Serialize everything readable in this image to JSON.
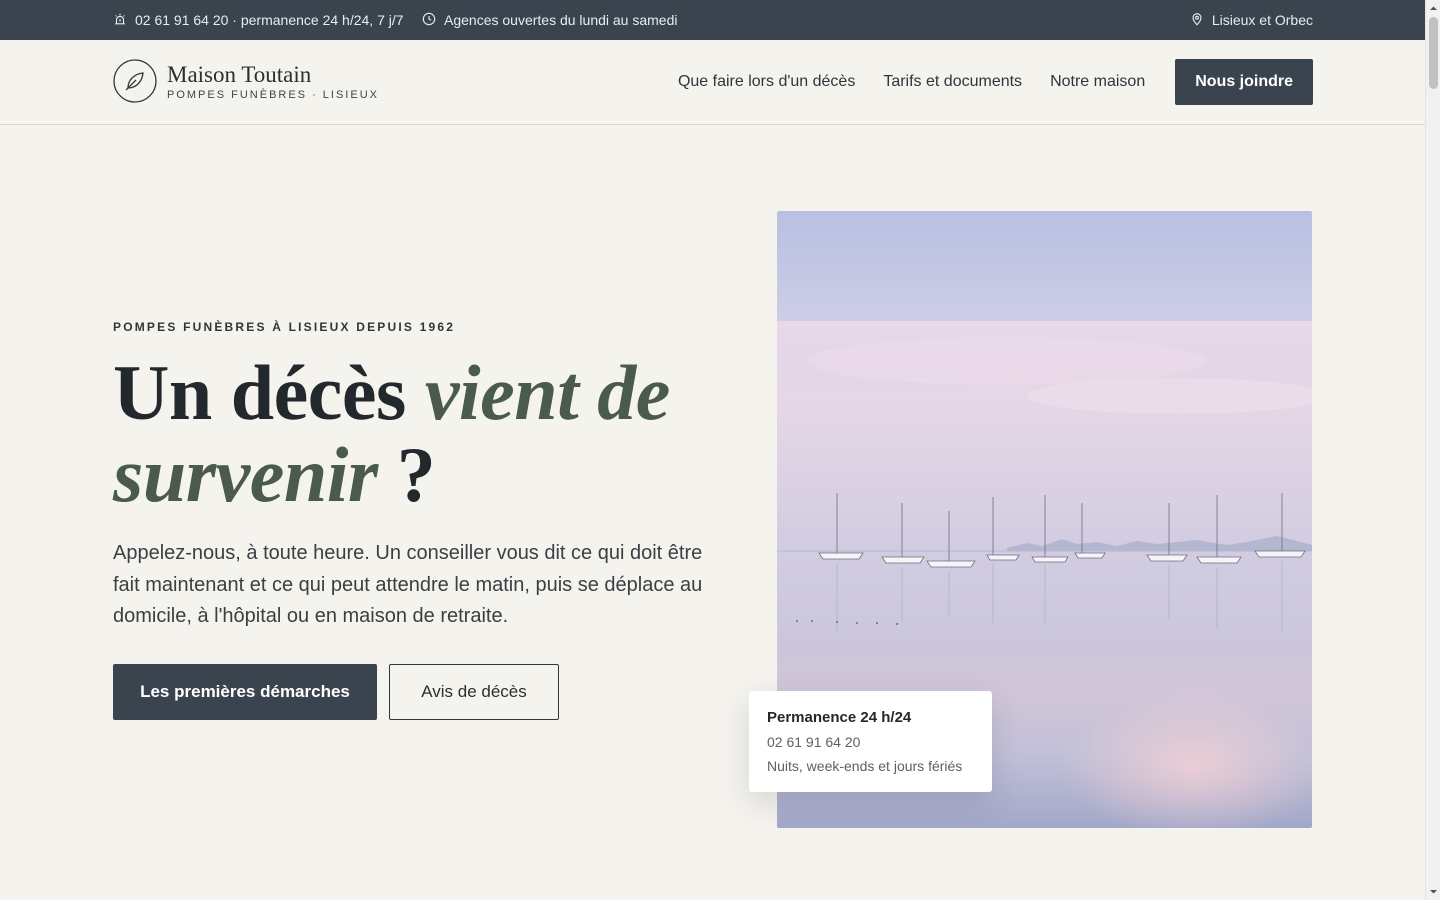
{
  "topbar": {
    "phone_text": "02 61 91 64 20 · permanence 24 h/24, 7 j/7",
    "phone_icon": "siren-icon",
    "hours_text": "Agences ouvertes du lundi au samedi",
    "hours_icon": "clock-icon",
    "location_text": "Lisieux et Orbec",
    "location_icon": "map-pin-icon"
  },
  "header": {
    "logo_name": "Maison Toutain",
    "logo_sub": "POMPES FUNÈBRES · LISIEUX",
    "logo_icon": "leaf-icon",
    "nav": [
      {
        "label": "Que faire lors d'un décès"
      },
      {
        "label": "Tarifs et documents"
      },
      {
        "label": "Notre maison"
      }
    ],
    "cta_label": "Nous joindre"
  },
  "hero": {
    "eyebrow": "POMPES FUNÈBRES À LISIEUX DEPUIS 1962",
    "headline_plain": "Un décès ",
    "headline_accent": "vient de survenir",
    "headline_end": " ?",
    "lede": "Appelez-nous, à toute heure. Un conseiller vous dit ce qui doit être fait maintenant et ce qui peut attendre le matin, puis se déplace au domicile, à l'hôpital ou en maison de retraite.",
    "primary_button": "Les premières démarches",
    "secondary_button": "Avis de décès"
  },
  "card": {
    "title": "Permanence 24 h/24",
    "phone": "02 61 91 64 20",
    "note": "Nuits, week-ends et jours fériés"
  },
  "colors": {
    "dark": "#3a444e",
    "accent_green": "#4a5a4b",
    "background": "#f5f3ee"
  }
}
